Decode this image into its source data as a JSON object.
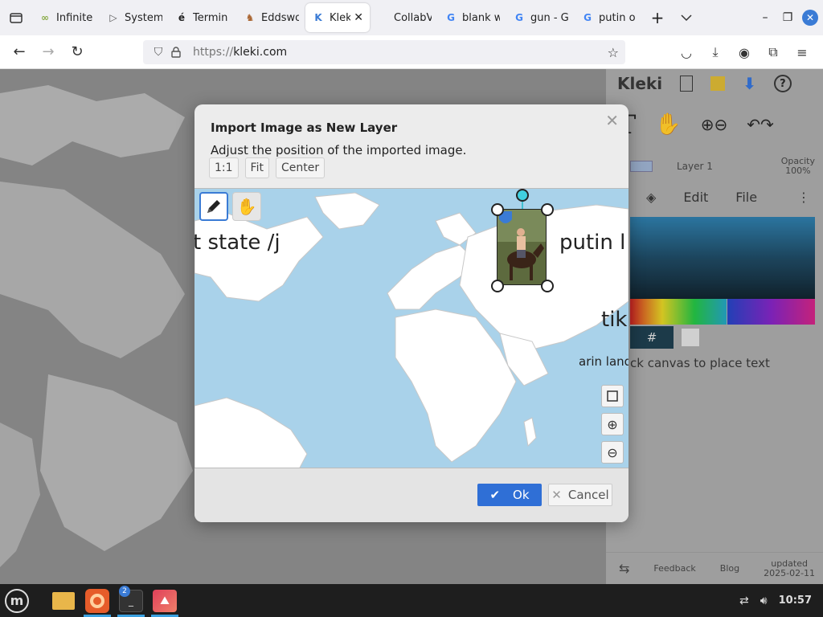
{
  "browser": {
    "tabs": [
      {
        "label": "Infinite",
        "favicon": "∞",
        "fav_color": "#8a4"
      },
      {
        "label": "System",
        "favicon": "▷",
        "fav_color": "#555"
      },
      {
        "label": "Termin",
        "favicon": "é",
        "fav_color": "#222"
      },
      {
        "label": "Eddswo",
        "favicon": "♞",
        "fav_color": "#a63"
      },
      {
        "label": "Kleki",
        "favicon": "K",
        "fav_color": "#3a7bd5",
        "active": true
      },
      {
        "label": "CollabVM C",
        "favicon": "",
        "fav_color": "#444"
      },
      {
        "label": "blank w",
        "favicon": "G",
        "fav_color": "#4285f4"
      },
      {
        "label": "gun - G",
        "favicon": "G",
        "fav_color": "#4285f4"
      },
      {
        "label": "putin o",
        "favicon": "G",
        "fav_color": "#4285f4"
      }
    ],
    "url_scheme": "https://",
    "url_host": "kleki.com"
  },
  "kleki": {
    "logo": "Kleki",
    "layer_name": "Layer 1",
    "opacity_label": "Opacity",
    "opacity_value": "100%",
    "tabs": [
      "Edit",
      "File"
    ],
    "hex_symbol": "#",
    "hint": "ck canvas to place text",
    "footer": {
      "feedback": "Feedback",
      "blog": "Blog",
      "updated_label": "updated",
      "updated_date": "2025-02-11"
    }
  },
  "dialog": {
    "title": "Import Image as New Layer",
    "subtitle": "Adjust the position of the imported image.",
    "buttons": {
      "one_to_one": "1:1",
      "fit": "Fit",
      "center": "Center"
    },
    "ok_label": "Ok",
    "cancel_label": "Cancel",
    "preview_texts": {
      "state": "t state /j",
      "putin": "putin l",
      "tik": "tik",
      "arin": "arin land"
    }
  },
  "taskbar": {
    "terminal_badge": "2",
    "clock": "10:57"
  }
}
